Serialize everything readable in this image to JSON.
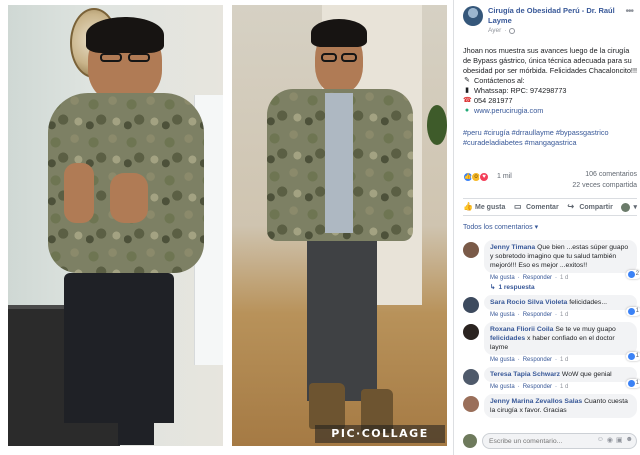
{
  "post": {
    "page_name": "Cirugía de Obesidad Perú - Dr. Raúl Layme",
    "time": "Ayer",
    "body_text": "Jhoan nos muestra sus avances luego de la cirugía de Bypass gástrico, única técnica adecuada para su obesidad por ser mórbida. Felicidades Chacaloncito!!!",
    "contact_heading": "Contáctenos al:",
    "whatsapp_text": "Whatssap: RPC: 974298773",
    "phone_text": "054 281977",
    "website": "www.perucirugia.com",
    "hashtags": "#peru #cirugía #drraullayme #bypassgastrico #curadeladiabetes #mangagastrica"
  },
  "stats": {
    "reactions": "1 mil",
    "comments": "106 comentarios",
    "shares": "22 veces compartida"
  },
  "actions": {
    "like": "Me gusta",
    "comment": "Comentar",
    "share": "Compartir"
  },
  "comments_filter": "Todos los comentarios",
  "comments": [
    {
      "author": "Jenny Timana",
      "text": "Que bien ...estas súper guapo y sobretodo imagino que tu salud también mejoró!!! Eso es mejor ...exitos!!",
      "likes": "2",
      "like_label": "Me gusta",
      "reply_label": "Responder",
      "time": "1 d"
    },
    {
      "author": "Sara Rocio Silva Violeta",
      "text": "felicidades...",
      "likes": "1",
      "like_label": "Me gusta",
      "reply_label": "Responder",
      "time": "1 d"
    },
    {
      "author": "Roxana Fliorii Coila",
      "text": "Se te ve muy guapo",
      "tag": "felicidades",
      "text2": "x haber confiado en el doctor layme",
      "likes": "1",
      "like_label": "Me gusta",
      "reply_label": "Responder",
      "time": "1 d"
    },
    {
      "author": "Teresa Tapia Schwarz",
      "text": "WoW que genial",
      "likes": "1",
      "like_label": "Me gusta",
      "reply_label": "Responder",
      "time": "1 d"
    },
    {
      "author": "Jenny Marina Zevallos Salas",
      "text": "Cuanto cuesta la cirugía x favor. Gracias",
      "likes": "",
      "like_label": "",
      "reply_label": "",
      "time": ""
    }
  ],
  "replies_label": "1 respuesta",
  "comment_placeholder": "Escribe un comentario...",
  "watermark": "PIC·COLLAGE"
}
